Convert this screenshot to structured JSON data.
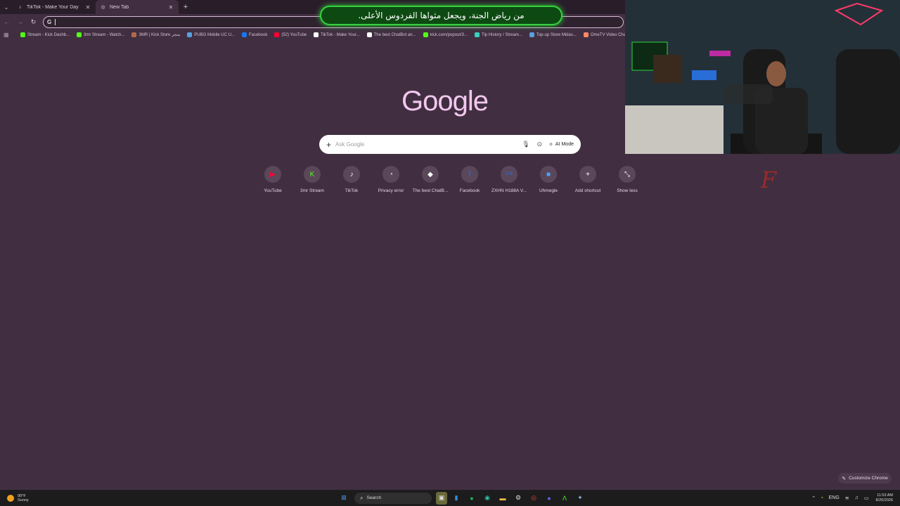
{
  "tabs": [
    {
      "title": "TikTok - Make Your Day",
      "icon": "tiktok-icon",
      "active": false
    },
    {
      "title": "New Tab",
      "icon": "chrome-icon",
      "active": true
    }
  ],
  "omnibox": {
    "value": ""
  },
  "bookmarks": [
    {
      "label": "Stream - Kick Dashb...",
      "icon": "kick-icon",
      "color": "#53fc18"
    },
    {
      "label": "3mr Stream - Watch...",
      "icon": "kick-icon",
      "color": "#53fc18"
    },
    {
      "label": "3MR | Kick Store متجر",
      "icon": "store-icon",
      "color": "#b06a4a"
    },
    {
      "label": "PUBG Mobile UC U...",
      "icon": "globe-icon",
      "color": "#5aa0e0"
    },
    {
      "label": "Facebook",
      "icon": "facebook-icon",
      "color": "#1877f2"
    },
    {
      "label": "(52) YouTube",
      "icon": "youtube-icon",
      "color": "#ff0033"
    },
    {
      "label": "TikTok - Make Your...",
      "icon": "tiktok-icon",
      "color": "#ffffff"
    },
    {
      "label": "The best ChatBot an...",
      "icon": "chatbot-icon",
      "color": "#ffffff"
    },
    {
      "label": "kick.com/popout/3...",
      "icon": "kick-icon",
      "color": "#53fc18"
    },
    {
      "label": "Tip History / Stream...",
      "icon": "tip-icon",
      "color": "#39d0c0"
    },
    {
      "label": "Top-up Store Midas...",
      "icon": "globe-icon",
      "color": "#5aa0e0"
    },
    {
      "label": "OmeTV Video Chat...",
      "icon": "ometv-icon",
      "color": "#ff8a65"
    }
  ],
  "logo": "Google",
  "search": {
    "placeholder": "Ask Google",
    "ai_mode": "AI Mode"
  },
  "shortcuts": [
    {
      "label": "YouTube",
      "icon": "youtube-icon",
      "glyph": "▶",
      "color": "#ff0033"
    },
    {
      "label": "3mr Stream",
      "icon": "kick-icon",
      "glyph": "K",
      "color": "#53fc18"
    },
    {
      "label": "TikTok",
      "icon": "tiktok-icon",
      "glyph": "♪",
      "color": "#ffffff"
    },
    {
      "label": "Privacy error",
      "icon": "privacy-icon",
      "glyph": "◔",
      "color": "#dddddd"
    },
    {
      "label": "The best ChatB...",
      "icon": "chatbot-icon",
      "glyph": "◆",
      "color": "#ffffff"
    },
    {
      "label": "Facebook",
      "icon": "facebook-icon",
      "glyph": "f",
      "color": "#1877f2"
    },
    {
      "label": "ZXHN H188A V...",
      "icon": "zte-icon",
      "glyph": "ZTE",
      "color": "#2e6fd1"
    },
    {
      "label": "Uhmegle",
      "icon": "uhmegle-icon",
      "glyph": "■",
      "color": "#4aa3ff"
    },
    {
      "label": "Add shortcut",
      "icon": "add-icon",
      "glyph": "+",
      "color": "#ffffff"
    },
    {
      "label": "Show less",
      "icon": "collapse-icon",
      "glyph": "⤡",
      "color": "#ffffff"
    }
  ],
  "overlay": {
    "banner_text": "من رياض الجنة، ويجعل مثواها الفردوس الأعلى."
  },
  "customize": {
    "label": "Customize Chrome"
  },
  "taskbar": {
    "weather_temp": "90°F",
    "weather_desc": "Sunny",
    "search_label": "Search",
    "lang": "ENG",
    "time": "11:53 AM",
    "date": "8/25/2026"
  }
}
